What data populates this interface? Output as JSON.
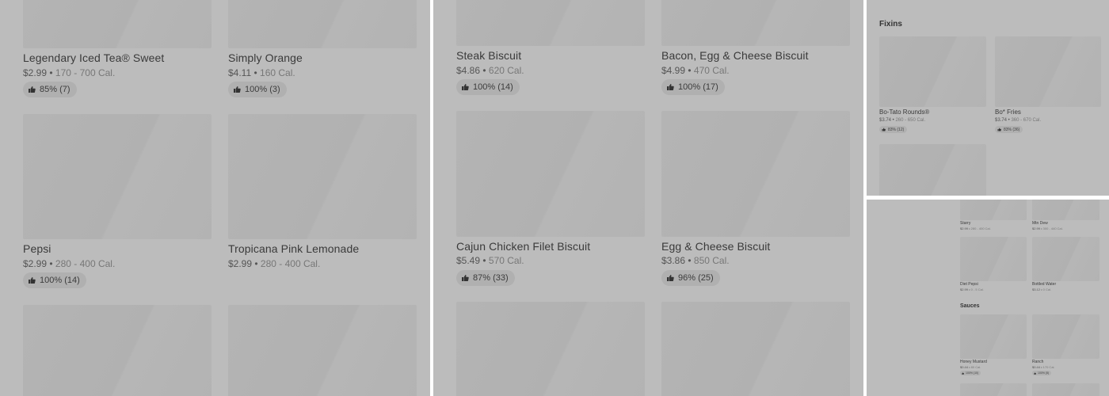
{
  "panel1": {
    "items": [
      {
        "name": "Legendary Iced Tea® Sweet",
        "price": "$2.99",
        "cal": "170 - 700 Cal.",
        "rating": "85% (7)"
      },
      {
        "name": "Simply Orange",
        "price": "$4.11",
        "cal": "160 Cal.",
        "rating": "100% (3)"
      },
      {
        "name": "Pepsi",
        "price": "$2.99",
        "cal": "280 - 400 Cal.",
        "rating": "100% (14)"
      },
      {
        "name": "Tropicana Pink Lemonade",
        "price": "$2.99",
        "cal": "280 - 400 Cal.",
        "rating": ""
      }
    ]
  },
  "panel2": {
    "items": [
      {
        "name": "Steak Biscuit",
        "price": "$4.86",
        "cal": "620 Cal.",
        "rating": "100% (14)"
      },
      {
        "name": "Bacon, Egg & Cheese Biscuit",
        "price": "$4.99",
        "cal": "470 Cal.",
        "rating": "100% (17)"
      },
      {
        "name": "Cajun Chicken Filet Biscuit",
        "price": "$5.49",
        "cal": "570 Cal.",
        "rating": "87% (33)"
      },
      {
        "name": "Egg & Cheese Biscuit",
        "price": "$3.86",
        "cal": "850 Cal.",
        "rating": "96% (25)"
      }
    ]
  },
  "panel3": {
    "section_title": "Fixins",
    "items": [
      {
        "name": "Bo-Tato Rounds®",
        "price": "$3.74",
        "cal": "260 - 650 Cal.",
        "rating": "83% (12)"
      },
      {
        "name": "Bo* Fries",
        "price": "$3.74",
        "cal": "360 - 670 Cal.",
        "rating": "83% (36)"
      }
    ]
  },
  "panel4": {
    "items_top": [
      {
        "name": "Starry",
        "price": "$2.99",
        "cal": "280 - 400 Cal."
      },
      {
        "name": "Mtn Dew",
        "price": "$2.99",
        "cal": "300 - 440 Cal."
      },
      {
        "name": "Diet Pepsi",
        "price": "$2.99",
        "cal": "0 - 5 Cal."
      },
      {
        "name": "Bottled Water",
        "price": "$3.12",
        "cal": "0 Cal."
      }
    ],
    "section_title": "Sauces",
    "sauces": [
      {
        "name": "Honey Mustard",
        "price": "$0.44",
        "cal": "80 Cal.",
        "rating": "100% (10)"
      },
      {
        "name": "Ranch",
        "price": "$0.44",
        "cal": "170 Cal.",
        "rating": "100% (5)"
      }
    ]
  },
  "icons": {
    "rating": "thumbs-up-icon"
  },
  "colors": {
    "overlay": "#bcbcbc",
    "image_placeholder": "#b3b3b3",
    "badge": "#b0b0b0"
  }
}
